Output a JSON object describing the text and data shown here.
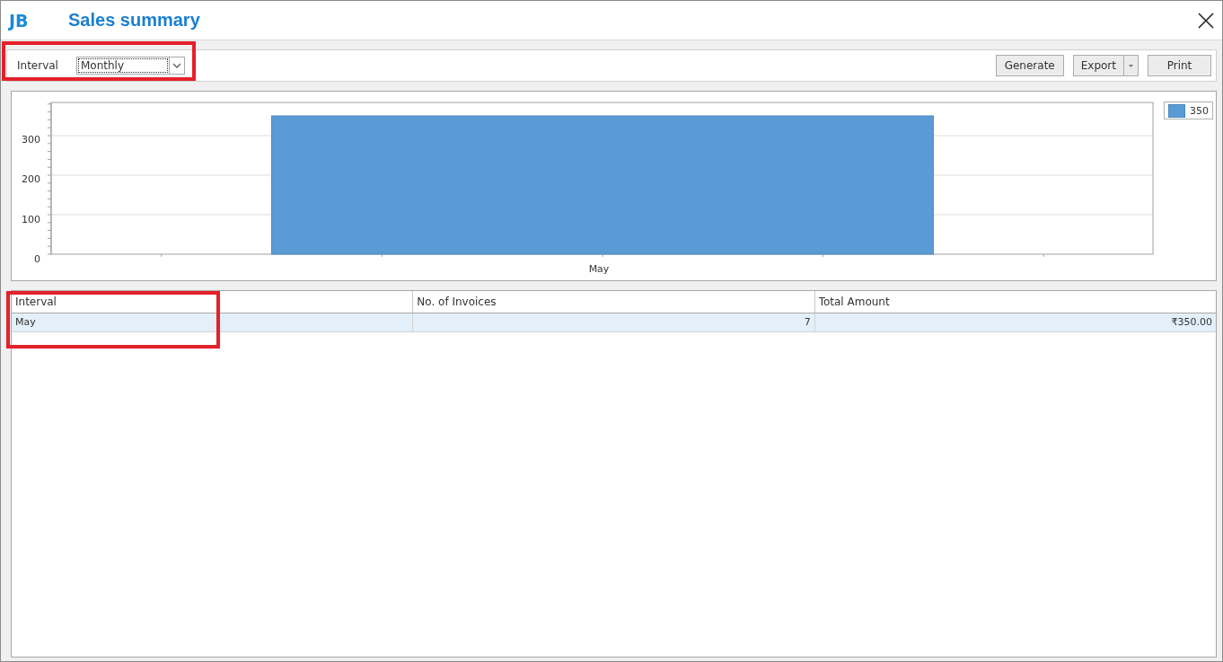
{
  "window": {
    "title": "Sales summary",
    "logo": "JB"
  },
  "toolbar": {
    "interval_label": "Interval",
    "interval_value": "Monthly",
    "buttons": [
      {
        "label": "Generate",
        "kind": "plain"
      },
      {
        "label": "Export",
        "kind": "split"
      },
      {
        "label": "Print",
        "kind": "plain"
      }
    ]
  },
  "chart": {
    "chart_data": {
      "type": "bar",
      "grid": true,
      "categories": [
        "May"
      ],
      "series": [
        {
          "name": "350",
          "color": "#5b9bd5",
          "values": [
            350
          ]
        }
      ],
      "ylim": [
        0,
        384
      ],
      "yticks": [
        0,
        100,
        200,
        300
      ]
    }
  },
  "table": {
    "columns": [
      "Interval",
      "No. of Invoices",
      "Total Amount"
    ],
    "rows": [
      {
        "cells": [
          "May",
          "7",
          "₹350.00"
        ],
        "selected": true
      }
    ]
  }
}
